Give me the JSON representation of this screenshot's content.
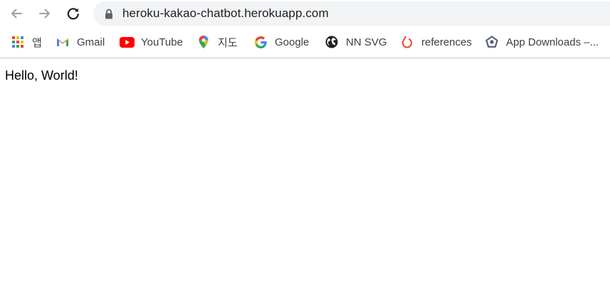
{
  "browser": {
    "url": "heroku-kakao-chatbot.herokuapp.com",
    "colors": {
      "omnibox_bg": "#f1f3f4",
      "icon_gray": "#5f6368"
    }
  },
  "bookmarks": [
    {
      "label": "앱",
      "icon": "apps-grid-icon"
    },
    {
      "label": "Gmail",
      "icon": "gmail-icon"
    },
    {
      "label": "YouTube",
      "icon": "youtube-icon"
    },
    {
      "label": "지도",
      "icon": "maps-pin-icon"
    },
    {
      "label": "Google",
      "icon": "google-icon"
    },
    {
      "label": "NN SVG",
      "icon": "globe-icon"
    },
    {
      "label": "references",
      "icon": "flame-icon"
    },
    {
      "label": "App Downloads –...",
      "icon": "pentagon-icon"
    }
  ],
  "page": {
    "text": "Hello, World!"
  }
}
